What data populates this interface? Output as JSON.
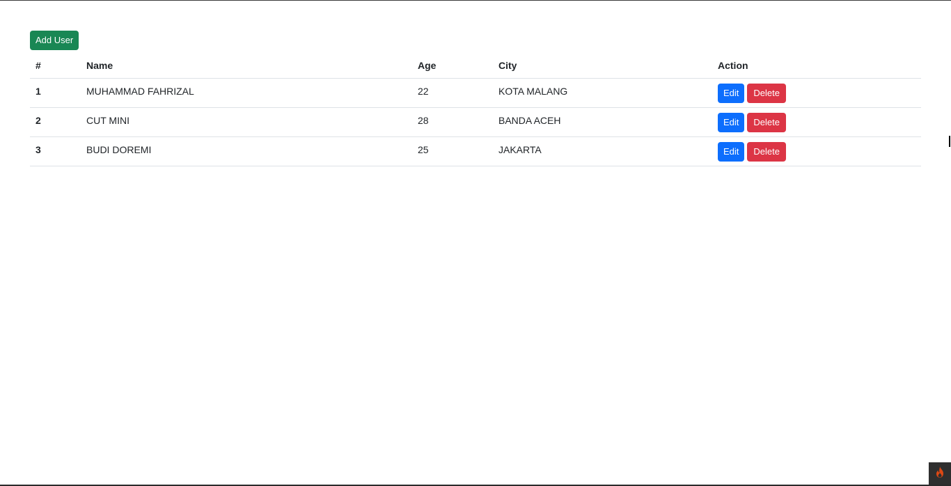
{
  "toolbar": {
    "add_label": "Add User"
  },
  "table": {
    "headers": [
      "#",
      "Name",
      "Age",
      "City",
      "Action"
    ],
    "rows": [
      {
        "num": "1",
        "name": "MUHAMMAD FAHRIZAL",
        "age": "22",
        "city": "KOTA MALANG",
        "edit": "Edit",
        "delete": "Delete"
      },
      {
        "num": "2",
        "name": "CUT MINI",
        "age": "28",
        "city": "BANDA ACEH",
        "edit": "Edit",
        "delete": "Delete"
      },
      {
        "num": "3",
        "name": "BUDI DOREMI",
        "age": "25",
        "city": "JAKARTA",
        "edit": "Edit",
        "delete": "Delete"
      }
    ]
  },
  "colors": {
    "add_button": "#198754",
    "edit_button": "#0d6efd",
    "delete_button": "#dc3545"
  },
  "icons": {
    "corner_widget": "flame-icon"
  }
}
